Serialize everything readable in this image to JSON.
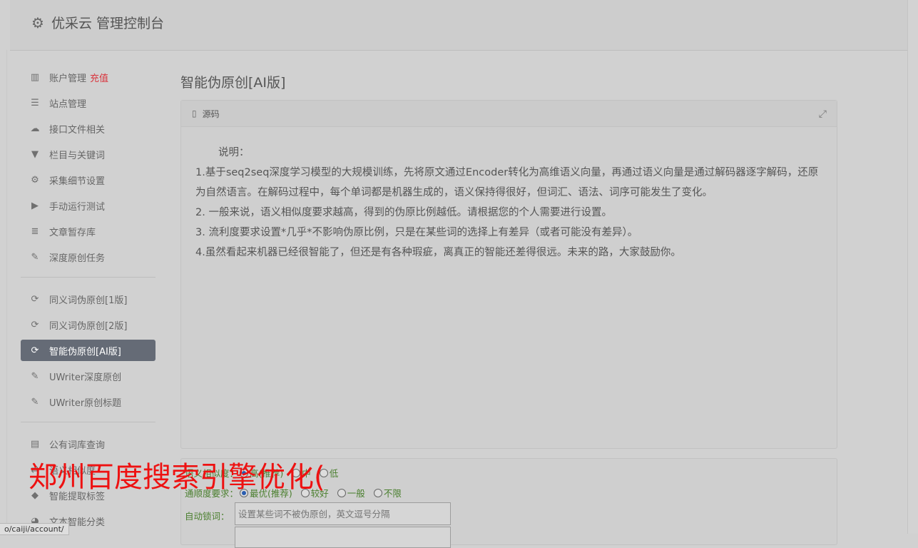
{
  "header": {
    "title": "优采云 管理控制台",
    "icon": "gear-icon"
  },
  "sidebar": {
    "group1": [
      {
        "label": "账户管理",
        "extra": "充值",
        "icon": "bar-chart-icon"
      },
      {
        "label": "站点管理",
        "icon": "server-icon"
      },
      {
        "label": "接口文件相关",
        "icon": "cloud-upload-icon"
      },
      {
        "label": "栏目与关键词",
        "icon": "filter-icon"
      },
      {
        "label": "采集细节设置",
        "icon": "cogs-icon"
      },
      {
        "label": "手动运行测试",
        "icon": "play-circle-icon"
      },
      {
        "label": "文章暂存库",
        "icon": "database-icon"
      },
      {
        "label": "深度原创任务",
        "icon": "edit-icon"
      }
    ],
    "group2": [
      {
        "label": "同义词伪原创[1版]",
        "icon": "refresh-icon"
      },
      {
        "label": "同义词伪原创[2版]",
        "icon": "refresh-icon"
      },
      {
        "label": "智能伪原创[AI版]",
        "icon": "refresh-icon",
        "active": true
      },
      {
        "label": "UWriter深度原创",
        "icon": "edit-icon"
      },
      {
        "label": "UWriter原创标题",
        "icon": "edit-icon"
      }
    ],
    "group3": [
      {
        "label": "公有词库查询",
        "icon": "book-icon"
      },
      {
        "label": "语义相似度",
        "icon": "compare-icon"
      },
      {
        "label": "智能提取标签",
        "icon": "tag-icon"
      },
      {
        "label": "文本智能分类",
        "icon": "pie-chart-icon"
      }
    ]
  },
  "main": {
    "title": "智能伪原创[AI版]",
    "panel_title": "源码",
    "desc_heading": "说明：",
    "desc_lines": [
      "1.基于seq2seq深度学习模型的大规模训练，先将原文通过Encoder转化为高维语义向量，再通过语义向量是通过解码器逐字解码，还原为自然语言。在解码过程中，每个单词都是机器生成的，语义保持得很好，但词汇、语法、词序可能发生了变化。",
      "2. 一般来说，语义相似度要求越高，得到的伪原比例越低。请根据您的个人需要进行设置。",
      "3. 流利度要求设置*几乎*不影响伪原比例，只是在某些词的选择上有差异（或者可能没有差异）。",
      "4.虽然看起来机器已经很智能了，但还是有各种瑕疵，离真正的智能还差得很远。未来的路，大家鼓励你。"
    ],
    "similarity": {
      "label": "语义相似度：",
      "options": [
        "高(推荐)",
        "中",
        "低"
      ],
      "selected": 0
    },
    "fluency": {
      "label": "通顺度要求：",
      "options": [
        "最优(推荐)",
        "较好",
        "一般",
        "不限"
      ],
      "selected": 0
    },
    "autolock": {
      "label": "自动锁词：",
      "placeholder": "设置某些词不被伪原创，英文逗号分隔"
    }
  },
  "overlay": {
    "watermark": "郑州百度搜索引擎优化("
  },
  "statusbar": {
    "url": "o/caiji/account/"
  }
}
